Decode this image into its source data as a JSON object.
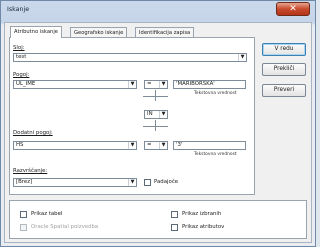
{
  "window": {
    "title": "Iskanje",
    "close_glyph": "✕"
  },
  "tabs": [
    {
      "label": "Atributno iskanje"
    },
    {
      "label": "Geografsko iskanje"
    },
    {
      "label": "Identifikacija zapisa"
    }
  ],
  "sloj": {
    "label": "Sloj:",
    "value": "test"
  },
  "pogoj": {
    "label": "Pogoj:",
    "field": "UL_IME",
    "operator": "=",
    "value": "'MARIBORSKA'",
    "hint": "Tekstovna vrednost"
  },
  "connector": {
    "value": "IN"
  },
  "dodatni_pogoj": {
    "label": "Dodatni pogoj:",
    "field": "HS",
    "operator": "=",
    "value": "'3'",
    "hint": "Tekstovna vrednost"
  },
  "razvrscanje": {
    "label": "Razvrščanje:",
    "value": "[Brez]",
    "padajoce_label": "Padajoče"
  },
  "buttons": {
    "ok": "V redu",
    "cancel": "Prekliči",
    "preveri": "Preveri"
  },
  "options": {
    "prikaz_tabel": "Prikaz tabel",
    "oracle_spatial": "Oracle Spatial poizvedba",
    "prikaz_izbranih": "Prikaz izbranih",
    "prikaz_atributov": "Prikaz atributov"
  },
  "icons": {
    "dropdown": "chevron-down-icon",
    "close": "close-icon"
  }
}
